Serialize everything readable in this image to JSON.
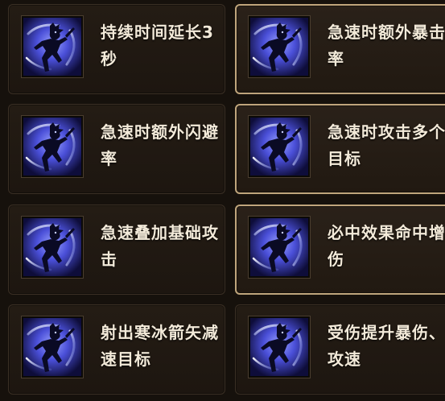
{
  "skills": [
    {
      "label": "持续时间延长3秒",
      "icon": "ninja-dash-icon",
      "selected": false
    },
    {
      "label": "急速时额外暴击率",
      "icon": "ninja-dash-icon",
      "selected": true
    },
    {
      "label": "急速时额外闪避率",
      "icon": "ninja-dash-icon",
      "selected": false
    },
    {
      "label": "急速时攻击多个目标",
      "icon": "ninja-dash-icon",
      "selected": true
    },
    {
      "label": "急速叠加基础攻击",
      "icon": "ninja-dash-icon",
      "selected": false
    },
    {
      "label": "必中效果命中增伤",
      "icon": "ninja-dash-icon",
      "selected": true
    },
    {
      "label": "射出寒冰箭矢减速目标",
      "icon": "ninja-dash-icon",
      "selected": false
    },
    {
      "label": "受伤提升暴伤、攻速",
      "icon": "ninja-dash-icon",
      "selected": false
    }
  ],
  "colors": {
    "card_border": "#3a2f24",
    "selected_border": "#bfa57c",
    "text": "#f3ead9",
    "icon_glow": "#6f74ff"
  }
}
